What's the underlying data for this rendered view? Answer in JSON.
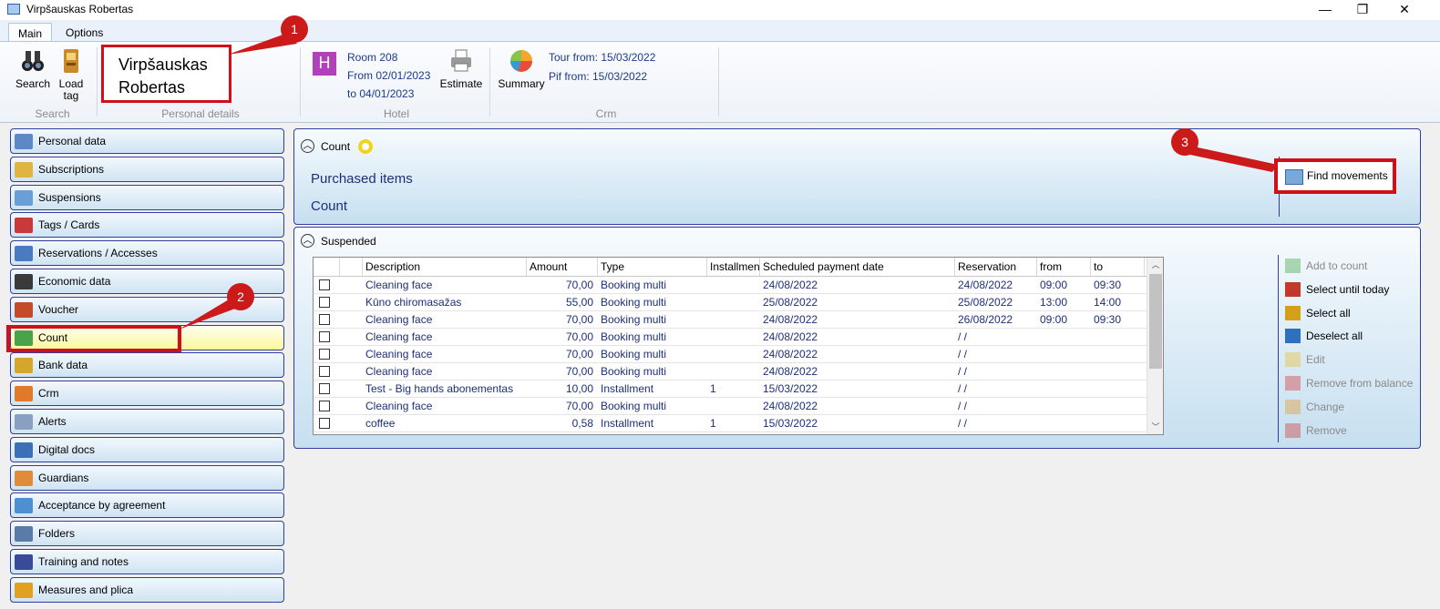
{
  "window": {
    "title": "Virpšauskas Robertas",
    "minimize": "—",
    "maximize": "❐",
    "close": "✕"
  },
  "tabs": [
    "Main",
    "Options"
  ],
  "ribbon": {
    "search": {
      "buttons": [
        {
          "label": "Search",
          "icon": "binoculars-icon"
        },
        {
          "label": "Load tag",
          "icon": "tag-loader-icon"
        }
      ],
      "group_label": "Search"
    },
    "personal": {
      "name_line1": "Virpšauskas",
      "name_line2": "Robertas",
      "group_label": "Personal details"
    },
    "hotel": {
      "badge": "H",
      "room": "Room 208",
      "from": "From 02/01/2023",
      "to": "to 04/01/2023",
      "estimate_label": "Estimate",
      "group_label": "Hotel"
    },
    "crm": {
      "summary_label": "Summary",
      "tour_from": "Tour from: 15/03/2022",
      "pif_from": "Pif from: 15/03/2022",
      "group_label": "Crm"
    }
  },
  "sidebar": {
    "items": [
      {
        "label": "Personal data",
        "icon_color": "#5d87c5"
      },
      {
        "label": "Subscriptions",
        "icon_color": "#e0b443"
      },
      {
        "label": "Suspensions",
        "icon_color": "#6a9ed6"
      },
      {
        "label": "Tags / Cards",
        "icon_color": "#c83a3a"
      },
      {
        "label": "Reservations / Accesses",
        "icon_color": "#4a7bc0"
      },
      {
        "label": "Economic data",
        "icon_color": "#3a3a3a"
      },
      {
        "label": "Voucher",
        "icon_color": "#c44a2a"
      },
      {
        "label": "Count",
        "icon_color": "#4aa34a"
      },
      {
        "label": "Bank data",
        "icon_color": "#d4a72c"
      },
      {
        "label": "Crm",
        "icon_color": "#e07a2a"
      },
      {
        "label": "Alerts",
        "icon_color": "#8aa0c0"
      },
      {
        "label": "Digital docs",
        "icon_color": "#3d6fb6"
      },
      {
        "label": "Guardians",
        "icon_color": "#e08a3a"
      },
      {
        "label": "Acceptance by agreement",
        "icon_color": "#4d8fd0"
      },
      {
        "label": "Folders",
        "icon_color": "#5a7aa8"
      },
      {
        "label": "Training and notes",
        "icon_color": "#3a4a9a"
      },
      {
        "label": "Measures and plica",
        "icon_color": "#e0a020"
      }
    ],
    "selected_index": 7
  },
  "count_panel": {
    "title": "Count",
    "purchased": "Purchased items",
    "count": "Count",
    "find_label": "Find movements"
  },
  "suspended_panel": {
    "title": "Suspended",
    "columns": [
      "Description",
      "Amount",
      "Type",
      "Installmen",
      "Scheduled payment date",
      "Reservation",
      "from",
      "to"
    ],
    "rows": [
      {
        "desc": "Cleaning face",
        "amount": "70,00",
        "type": "Booking multi",
        "inst": "",
        "sched": "24/08/2022",
        "res": "24/08/2022",
        "from": "09:00",
        "to": "09:30"
      },
      {
        "desc": "Kūno chiromasažas",
        "amount": "55,00",
        "type": "Booking multi",
        "inst": "",
        "sched": "25/08/2022",
        "res": "25/08/2022",
        "from": "13:00",
        "to": "14:00"
      },
      {
        "desc": "Cleaning face",
        "amount": "70,00",
        "type": "Booking multi",
        "inst": "",
        "sched": "24/08/2022",
        "res": "26/08/2022",
        "from": "09:00",
        "to": "09:30"
      },
      {
        "desc": "Cleaning face",
        "amount": "70,00",
        "type": "Booking multi",
        "inst": "",
        "sched": "24/08/2022",
        "res": " /  /",
        "from": "",
        "to": ""
      },
      {
        "desc": "Cleaning face",
        "amount": "70,00",
        "type": "Booking multi",
        "inst": "",
        "sched": "24/08/2022",
        "res": " /  /",
        "from": "",
        "to": ""
      },
      {
        "desc": "Cleaning face",
        "amount": "70,00",
        "type": "Booking multi",
        "inst": "",
        "sched": "24/08/2022",
        "res": " /  /",
        "from": "",
        "to": ""
      },
      {
        "desc": "Test - Big hands abonementas",
        "amount": "10,00",
        "type": "Installment",
        "inst": "1",
        "sched": "15/03/2022",
        "res": " /  /",
        "from": "",
        "to": ""
      },
      {
        "desc": "Cleaning face",
        "amount": "70,00",
        "type": "Booking multi",
        "inst": "",
        "sched": "24/08/2022",
        "res": " /  /",
        "from": "",
        "to": ""
      },
      {
        "desc": "coffee",
        "amount": "0,58",
        "type": "Installment",
        "inst": "1",
        "sched": "15/03/2022",
        "res": " /  /",
        "from": "",
        "to": ""
      }
    ],
    "actions": [
      {
        "label": "Add to count",
        "enabled": false,
        "icon_color": "#4caf50"
      },
      {
        "label": "Select until today",
        "enabled": true,
        "icon_color": "#c0392b"
      },
      {
        "label": "Select all",
        "enabled": true,
        "icon_color": "#d4a017"
      },
      {
        "label": "Deselect all",
        "enabled": true,
        "icon_color": "#2e6fc0"
      },
      {
        "label": "Edit",
        "enabled": false,
        "icon_color": "#e8c14a"
      },
      {
        "label": "Remove from balance",
        "enabled": false,
        "icon_color": "#d04a4a"
      },
      {
        "label": "Change",
        "enabled": false,
        "icon_color": "#e0a040"
      },
      {
        "label": "Remove",
        "enabled": false,
        "icon_color": "#d04a4a"
      }
    ]
  },
  "annotations": [
    "1",
    "2",
    "3"
  ]
}
